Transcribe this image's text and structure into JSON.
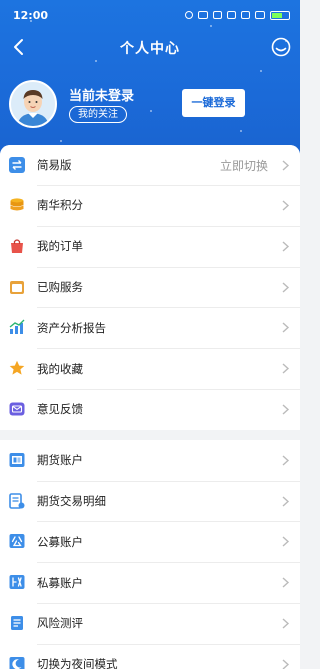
{
  "status_bar": {
    "time": "12:00"
  },
  "nav": {
    "title": "个人中心"
  },
  "profile": {
    "login_status": "当前未登录",
    "follow_label": "我的关注",
    "login_button": "一键登录"
  },
  "menu_group1": [
    {
      "label": "简易版",
      "value": "立即切换",
      "icon": "switch-icon",
      "color": "#3d8ee8"
    },
    {
      "label": "南华积分",
      "value": "",
      "icon": "coins-icon",
      "color": "#f0a020"
    },
    {
      "label": "我的订单",
      "value": "",
      "icon": "shopping-bag-icon",
      "color": "#e8534a"
    },
    {
      "label": "已购服务",
      "value": "",
      "icon": "purchased-bag-icon",
      "color": "#e8a23a"
    },
    {
      "label": "资产分析报告",
      "value": "",
      "icon": "bar-chart-icon",
      "color": "#3d8ee8"
    },
    {
      "label": "我的收藏",
      "value": "",
      "icon": "star-icon",
      "color": "#f5a623"
    },
    {
      "label": "意见反馈",
      "value": "",
      "icon": "mail-icon",
      "color": "#6b5fe0"
    }
  ],
  "menu_group2": [
    {
      "label": "期货账户",
      "icon": "futures-account-icon",
      "color": "#3d8ee8"
    },
    {
      "label": "期货交易明细",
      "icon": "trade-detail-icon",
      "color": "#3d8ee8"
    },
    {
      "label": "公募账户",
      "icon": "public-fund-icon",
      "color": "#3d8ee8"
    },
    {
      "label": "私募账户",
      "icon": "private-fund-icon",
      "color": "#3d8ee8"
    },
    {
      "label": "风险测评",
      "icon": "risk-assessment-icon",
      "color": "#3d8ee8"
    },
    {
      "label": "切换为夜间模式",
      "icon": "night-mode-icon",
      "color": "#3d8ee8"
    }
  ],
  "theme": {
    "header_blue": "#1b6ad8"
  }
}
